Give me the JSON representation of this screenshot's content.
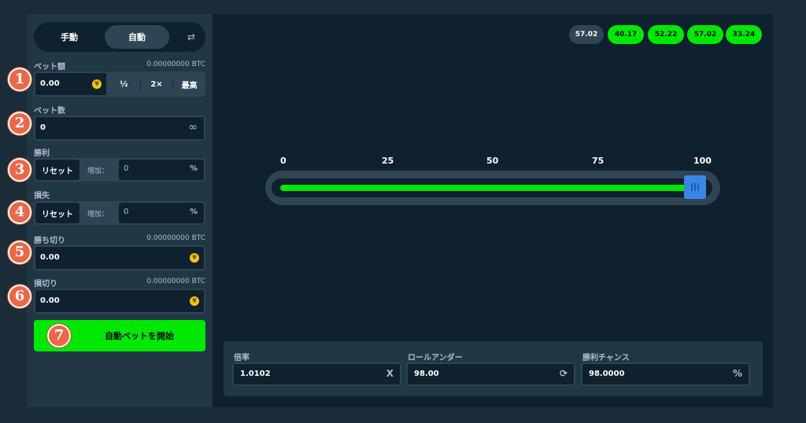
{
  "mode_tabs": {
    "manual": "手動",
    "auto": "自動"
  },
  "fields": {
    "bet_amount": {
      "label": "ベット額",
      "btc": "0.00000000 BTC",
      "value": "0.00",
      "half": "½",
      "double": "2×",
      "max": "最高"
    },
    "bet_count": {
      "label": "ベット数",
      "value": "0",
      "infinity": "∞"
    },
    "on_win": {
      "label": "勝利",
      "reset": "リセット",
      "increase_label": "増加：",
      "value": "0",
      "percent": "%"
    },
    "on_loss": {
      "label": "損失",
      "reset": "リセット",
      "increase_label": "増加：",
      "value": "0",
      "percent": "%"
    },
    "stop_profit": {
      "label": "勝ち切り",
      "btc": "0.00000000 BTC",
      "value": "0.00"
    },
    "stop_loss": {
      "label": "損切り",
      "btc": "0.00000000 BTC",
      "value": "0.00"
    }
  },
  "start_button": "自動ベットを開始",
  "markers": [
    "1",
    "2",
    "3",
    "4",
    "5",
    "6",
    "7"
  ],
  "history": [
    {
      "value": "57.02",
      "win": false
    },
    {
      "value": "40.17",
      "win": true
    },
    {
      "value": "52.22",
      "win": true
    },
    {
      "value": "57.02",
      "win": true
    },
    {
      "value": "33.24",
      "win": true
    }
  ],
  "slider": {
    "ticks": [
      "0",
      "25",
      "50",
      "75",
      "100"
    ],
    "value_percent": 98
  },
  "stats": {
    "multiplier": {
      "label": "倍率",
      "value": "1.0102",
      "icon": "X"
    },
    "roll_under": {
      "label": "ロールアンダー",
      "value": "98.00",
      "icon": "⟳"
    },
    "win_chance": {
      "label": "勝利チャンス",
      "value": "98.0000",
      "icon": "%"
    }
  },
  "colors": {
    "accent_green": "#00e701",
    "panel": "#213743",
    "bg": "#0f212e",
    "marker": "#e8694a",
    "handle": "#3a86e8"
  }
}
